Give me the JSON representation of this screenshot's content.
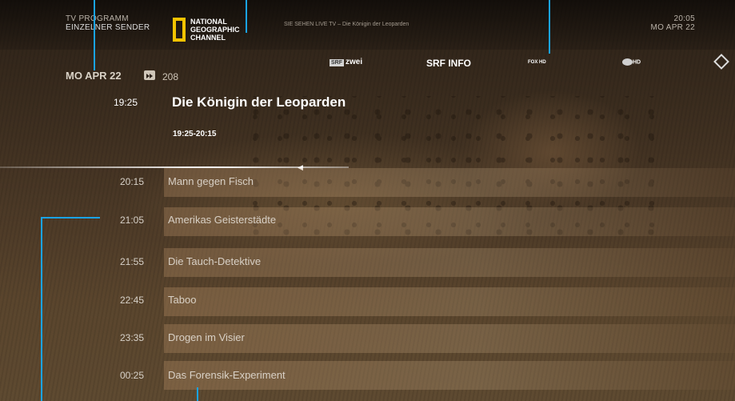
{
  "header": {
    "program_line1": "TV PROGRAMM",
    "program_line2": "EINZELNER SENDER",
    "now_playing": "SIE SEHEN LIVE TV – Die Königin der Leoparden",
    "clock_time": "20:05",
    "clock_date": "MO APR 22",
    "channel_logo_lines": [
      "NATIONAL",
      "GEOGRAPHIC",
      "CHANNEL"
    ]
  },
  "guide": {
    "date": "MO APR 22",
    "channel_number": "208"
  },
  "channels": [
    {
      "label": "zwei"
    },
    {
      "label": "SRF INFO"
    },
    {
      "label": "FOX HD"
    },
    {
      "label": "HD"
    },
    {
      "label": ""
    }
  ],
  "current": {
    "time": "19:25",
    "title": "Die Königin der Leoparden",
    "range": "19:25-20:15"
  },
  "schedule": [
    {
      "time": "20:15",
      "title": "Mann gegen Fisch"
    },
    {
      "time": "21:05",
      "title": "Amerikas Geisterstädte"
    },
    {
      "time": "21:55",
      "title": "Die Tauch-Detektive"
    },
    {
      "time": "22:45",
      "title": "Taboo"
    },
    {
      "time": "23:35",
      "title": "Drogen im Visier"
    },
    {
      "time": "00:25",
      "title": "Das Forensik-Experiment"
    }
  ],
  "colors": {
    "accent": "#1aa3e6",
    "logo_yellow": "#f3c300"
  }
}
